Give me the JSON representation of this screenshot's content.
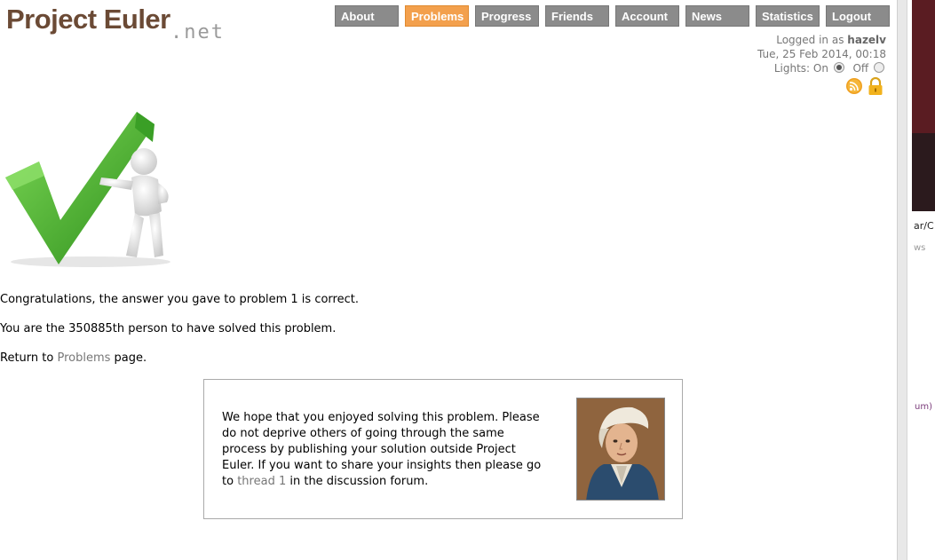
{
  "logo": {
    "main": "Project Euler",
    "suffix": ".net"
  },
  "nav": [
    {
      "label": "About",
      "active": false
    },
    {
      "label": "Problems",
      "active": true
    },
    {
      "label": "Progress",
      "active": false
    },
    {
      "label": "Friends",
      "active": false
    },
    {
      "label": "Account",
      "active": false
    },
    {
      "label": "News",
      "active": false
    },
    {
      "label": "Statistics",
      "active": false
    },
    {
      "label": "Logout",
      "active": false
    }
  ],
  "user": {
    "logged_prefix": "Logged in as",
    "username": "hazelv",
    "datetime": "Tue, 25 Feb 2014, 00:18",
    "lights_label": "Lights:",
    "on_label": "On",
    "off_label": "Off",
    "lights_on": true
  },
  "icons": {
    "rss": "rss-icon",
    "lock": "lock-icon"
  },
  "colors": {
    "accent": "#f3a04d",
    "brand": "#6b4a35",
    "nav": "#8b8b8b",
    "check": "#4cb82d"
  },
  "result": {
    "congrats": "Congratulations, the answer you gave to problem 1 is correct.",
    "rank": "You are the 350885th person to have solved this problem.",
    "return_prefix": "Return to",
    "return_link": "Problems",
    "return_suffix": "page."
  },
  "forum_box": {
    "text_before": "We hope that you enjoyed solving this problem. Please do not deprive others of going through the same process by publishing your solution outside Project Euler. If you want to share your insights then please go to",
    "link": "thread 1",
    "text_after": "in the discussion forum."
  },
  "side_peek": {
    "t1": "ar/C",
    "t2": "ws",
    "t3": "um)"
  }
}
